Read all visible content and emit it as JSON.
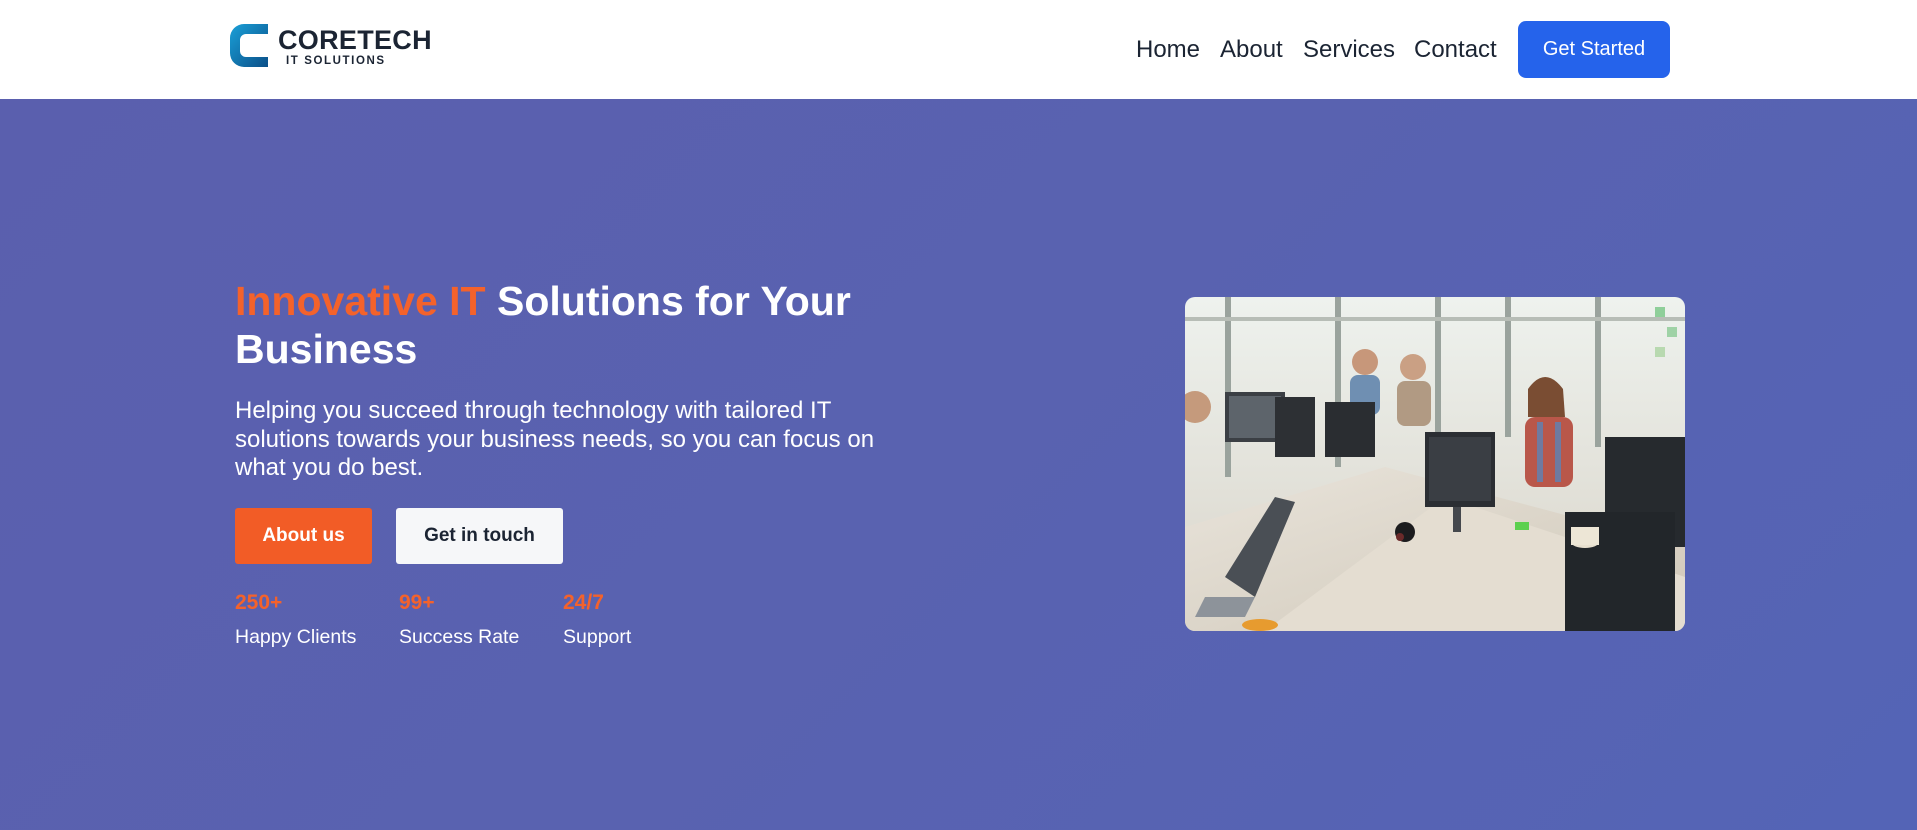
{
  "brand": {
    "name": "CORETECH",
    "tagline": "IT SOLUTIONS",
    "primary_color": "#2563eb",
    "accent_color": "#f25c26",
    "hero_background": "#5a61b0"
  },
  "nav": {
    "links": [
      {
        "label": "Home"
      },
      {
        "label": "About"
      },
      {
        "label": "Services"
      },
      {
        "label": "Contact"
      }
    ],
    "cta_label": "Get Started"
  },
  "hero": {
    "headline_accent": "Innovative IT",
    "headline_rest": " Solutions for Your Business",
    "subtext": "Helping you succeed through technology with tailored IT solutions towards your business needs, so you can focus on what you do best.",
    "primary_button": "About us",
    "secondary_button": "Get in touch",
    "stats": [
      {
        "value": "250+",
        "label": "Happy Clients"
      },
      {
        "value": "99+",
        "label": "Success Rate"
      },
      {
        "value": "24/7",
        "label": "Support"
      }
    ],
    "image_subject": "office-team-at-computers-photo"
  }
}
